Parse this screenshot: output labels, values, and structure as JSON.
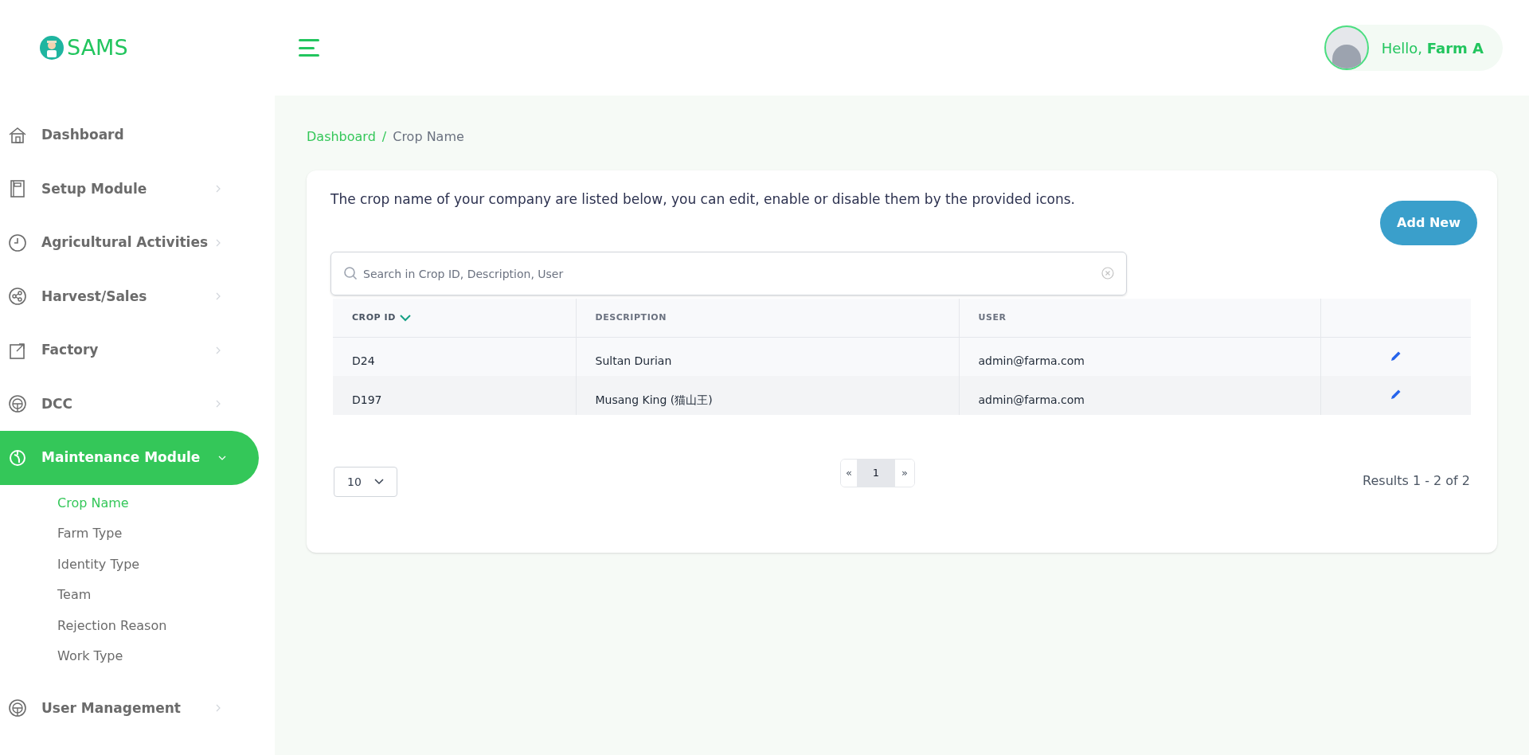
{
  "header": {
    "logo": "SAMS",
    "greeting": "Hello,",
    "user_name": "Farm A"
  },
  "sidebar": {
    "items": [
      {
        "label": "Dashboard",
        "has_arrow": false,
        "selected": false,
        "expanded": false
      },
      {
        "label": "Setup Module",
        "has_arrow": true,
        "selected": false,
        "expanded": false
      },
      {
        "label": "Agricultural Activities",
        "has_arrow": true,
        "selected": false,
        "expanded": false
      },
      {
        "label": "Harvest/Sales",
        "has_arrow": true,
        "selected": false,
        "expanded": false
      },
      {
        "label": "Factory",
        "has_arrow": true,
        "selected": false,
        "expanded": false
      },
      {
        "label": "DCC",
        "has_arrow": true,
        "selected": false,
        "expanded": false
      },
      {
        "label": "Maintenance Module",
        "has_arrow": true,
        "selected": true,
        "expanded": true,
        "children": [
          {
            "label": "Crop Name",
            "selected": true
          },
          {
            "label": "Farm Type",
            "selected": false
          },
          {
            "label": "Identity Type",
            "selected": false
          },
          {
            "label": "Team",
            "selected": false
          },
          {
            "label": "Rejection Reason",
            "selected": false
          },
          {
            "label": "Work Type",
            "selected": false
          }
        ]
      },
      {
        "label": "User Management",
        "has_arrow": true,
        "selected": false,
        "expanded": false
      }
    ]
  },
  "breadcrumb": {
    "separator": "/",
    "items": [
      {
        "label": "Dashboard",
        "kind": "link"
      },
      {
        "label": "Crop Name",
        "kind": "current"
      }
    ]
  },
  "description": "The crop name of your company are listed below, you can edit, enable or disable them by the provided icons.",
  "add_button": "Add New",
  "search": {
    "placeholder": "Search in Crop ID, Description, User"
  },
  "table": {
    "columns": [
      {
        "label": "CROP ID",
        "sorted": true
      },
      {
        "label": "DESCRIPTION",
        "sorted": false
      },
      {
        "label": "USER",
        "sorted": false
      }
    ],
    "rows": [
      {
        "cells": [
          "D24",
          "Sultan Durian",
          "admin@farma.com"
        ]
      },
      {
        "cells": [
          "D197",
          "Musang King (猫山王)",
          "admin@farma.com"
        ]
      }
    ]
  },
  "pagination": {
    "page_size": "10",
    "prev": "«",
    "pages": [
      {
        "label": "1",
        "selected": true
      }
    ],
    "next": "»",
    "results": "Results 1 - 2 of 2"
  }
}
